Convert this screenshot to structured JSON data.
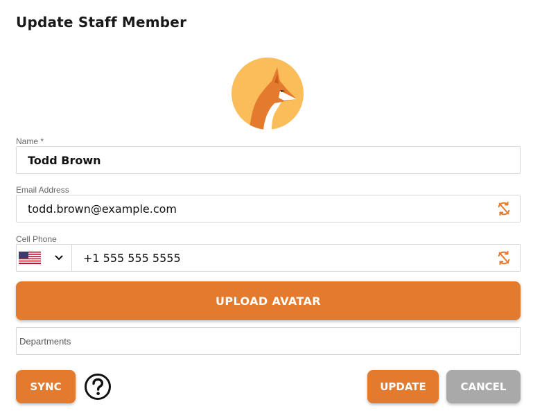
{
  "dialog": {
    "title": "Update Staff Member"
  },
  "avatar": {
    "icon": "fox-avatar-icon",
    "background_color": "#fbbd59",
    "fox_color": "#e47a2d"
  },
  "form": {
    "name": {
      "label": "Name *",
      "value": "Todd Brown"
    },
    "email": {
      "label": "Email Address",
      "value": "todd.brown@example.com",
      "icon": "sync-off-icon"
    },
    "phone": {
      "label": "Cell Phone",
      "country_icon": "us-flag-icon",
      "value": "+1 555 555 5555",
      "icon": "sync-off-icon"
    },
    "departments": {
      "placeholder": "Departments"
    }
  },
  "buttons": {
    "upload_avatar": "UPLOAD AVATAR",
    "sync": "SYNC",
    "help_icon": "question-circle-icon",
    "update": "UPDATE",
    "cancel": "CANCEL"
  },
  "colors": {
    "accent": "#e47a2d",
    "cancel": "#a9a9a9",
    "border": "#d6d6d6"
  }
}
